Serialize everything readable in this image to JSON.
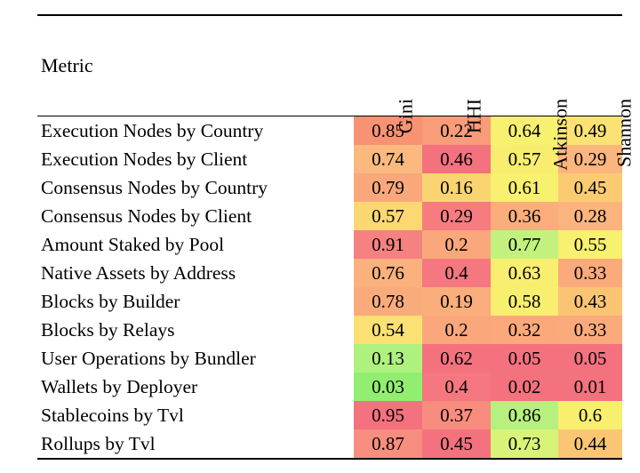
{
  "table": {
    "columns": [
      {
        "key": "metric",
        "label": "Metric",
        "rotated": false
      },
      {
        "key": "gini",
        "label": "Gini",
        "rotated": true
      },
      {
        "key": "hhi",
        "label": "HHI",
        "rotated": true
      },
      {
        "key": "atkinson",
        "label": "Atkinson",
        "rotated": true
      },
      {
        "key": "shannon",
        "label": "Shannon",
        "rotated": true
      }
    ],
    "rows": [
      {
        "metric": "Execution Nodes by Country",
        "values": [
          "0.85",
          "0.22",
          "0.64",
          "0.49"
        ],
        "colors": [
          "#F79273",
          "#F99C79",
          "#F8F06F",
          "#FAE274"
        ]
      },
      {
        "metric": "Execution Nodes by Client",
        "values": [
          "0.74",
          "0.46",
          "0.57",
          "0.29"
        ],
        "colors": [
          "#FBB97F",
          "#F4717E",
          "#F8ED6F",
          "#FBB67E"
        ]
      },
      {
        "metric": "Consensus Nodes by Country",
        "values": [
          "0.79",
          "0.16",
          "0.61",
          "0.45"
        ],
        "colors": [
          "#FAA87B",
          "#FBD472",
          "#F8F06F",
          "#FBCB71"
        ]
      },
      {
        "metric": "Consensus Nodes by Client",
        "values": [
          "0.57",
          "0.29",
          "0.36",
          "0.28"
        ],
        "colors": [
          "#FCD873",
          "#F67C7F",
          "#FBAD7C",
          "#FBB47E"
        ]
      },
      {
        "metric": "Amount Staked by Pool",
        "values": [
          "0.91",
          "0.2",
          "0.77",
          "0.55"
        ],
        "colors": [
          "#F58180",
          "#FAA77B",
          "#C2F27D",
          "#F8F06F"
        ]
      },
      {
        "metric": "Native Assets by Address",
        "values": [
          "0.76",
          "0.4",
          "0.63",
          "0.33"
        ],
        "colors": [
          "#FAB17D",
          "#F5777F",
          "#F9EE6F",
          "#FBAA7B"
        ]
      },
      {
        "metric": "Blocks by Builder",
        "values": [
          "0.78",
          "0.19",
          "0.58",
          "0.43"
        ],
        "colors": [
          "#FAAB7C",
          "#FAAE7C",
          "#F8EF6F",
          "#FBC473"
        ]
      },
      {
        "metric": "Blocks by Relays",
        "values": [
          "0.54",
          "0.2",
          "0.32",
          "0.33"
        ],
        "colors": [
          "#FBE074",
          "#FAA77B",
          "#FBA97B",
          "#FBAA7B"
        ]
      },
      {
        "metric": "User Operations by Bundler",
        "values": [
          "0.13",
          "0.62",
          "0.05",
          "0.05"
        ],
        "colors": [
          "#AFF17E",
          "#F4717E",
          "#F4717E",
          "#F4717E"
        ]
      },
      {
        "metric": "Wallets by Deployer",
        "values": [
          "0.03",
          "0.4",
          "0.02",
          "0.01"
        ],
        "colors": [
          "#92EE70",
          "#F5777F",
          "#F4717E",
          "#F4717E"
        ]
      },
      {
        "metric": "Stablecoins by Tvl",
        "values": [
          "0.95",
          "0.37",
          "0.86",
          "0.6"
        ],
        "colors": [
          "#F4717E",
          "#F88C7F",
          "#B6F07F",
          "#F8EF6F"
        ]
      },
      {
        "metric": "Rollups by Tvl",
        "values": [
          "0.87",
          "0.45",
          "0.73",
          "0.44"
        ],
        "colors": [
          "#F78E7F",
          "#F4717E",
          "#D8F478",
          "#FBC673"
        ]
      }
    ]
  },
  "chart_data": {
    "type": "table",
    "title": "",
    "categories": [
      "Execution Nodes by Country",
      "Execution Nodes by Client",
      "Consensus Nodes by Country",
      "Consensus Nodes by Client",
      "Amount Staked by Pool",
      "Native Assets by Address",
      "Blocks by Builder",
      "Blocks by Relays",
      "User Operations by Bundler",
      "Wallets by Deployer",
      "Stablecoins by Tvl",
      "Rollups by Tvl"
    ],
    "series": [
      {
        "name": "Gini",
        "values": [
          0.85,
          0.74,
          0.79,
          0.57,
          0.91,
          0.76,
          0.78,
          0.54,
          0.13,
          0.03,
          0.95,
          0.87
        ]
      },
      {
        "name": "HHI",
        "values": [
          0.22,
          0.46,
          0.16,
          0.29,
          0.2,
          0.4,
          0.19,
          0.2,
          0.62,
          0.4,
          0.37,
          0.45
        ]
      },
      {
        "name": "Atkinson",
        "values": [
          0.64,
          0.57,
          0.61,
          0.36,
          0.77,
          0.63,
          0.58,
          0.32,
          0.05,
          0.02,
          0.86,
          0.73
        ]
      },
      {
        "name": "Shannon",
        "values": [
          0.49,
          0.29,
          0.45,
          0.28,
          0.55,
          0.33,
          0.43,
          0.33,
          0.05,
          0.01,
          0.6,
          0.44
        ]
      }
    ],
    "xlabel": "Metric",
    "ylabel": "",
    "colormap": "RdYlGn",
    "colormap_notes": "Per-column heatmap shading; Gini and HHI reversed (high=red), Atkinson and Shannon normal (high=green)"
  }
}
